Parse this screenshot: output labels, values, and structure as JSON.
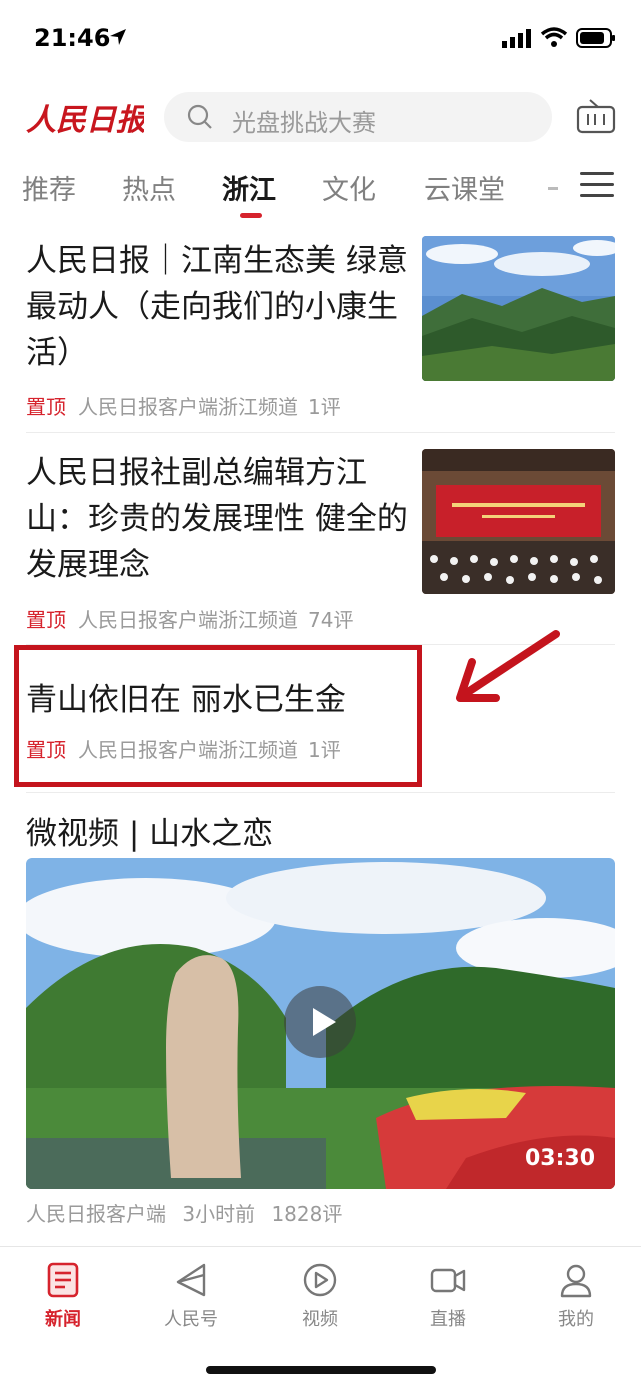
{
  "status_bar": {
    "time": "21:46"
  },
  "header": {
    "logo_text": "人民日报",
    "search_placeholder": "光盘挑战大赛"
  },
  "tabs": [
    {
      "label": "推荐"
    },
    {
      "label": "热点"
    },
    {
      "label": "浙江",
      "active": true
    },
    {
      "label": "文化"
    },
    {
      "label": "云课堂"
    }
  ],
  "articles": [
    {
      "title": "人民日报｜江南生态美 绿意最动人（走向我们的小康生活）",
      "pin": "置顶",
      "source": "人民日报客户端浙江频道",
      "comments": "1评"
    },
    {
      "title": "人民日报社副总编辑方江山：珍贵的发展理性 健全的发展理念",
      "pin": "置顶",
      "source": "人民日报客户端浙江频道",
      "comments": "74评"
    },
    {
      "title": "青山依旧在 丽水已生金",
      "pin": "置顶",
      "source": "人民日报客户端浙江频道",
      "comments": "1评"
    }
  ],
  "video": {
    "title": "微视频 | 山水之恋",
    "duration": "03:30",
    "source": "人民日报客户端",
    "time": "3小时前",
    "comments": "1828评"
  },
  "bottom_nav": [
    {
      "label": "新闻",
      "icon": "news-icon",
      "active": true
    },
    {
      "label": "人民号",
      "icon": "paper-plane-icon"
    },
    {
      "label": "视频",
      "icon": "video-play-icon"
    },
    {
      "label": "直播",
      "icon": "camera-icon"
    },
    {
      "label": "我的",
      "icon": "user-icon"
    }
  ],
  "colors": {
    "brand_red": "#d6232d",
    "highlight_red": "#c4141d"
  }
}
